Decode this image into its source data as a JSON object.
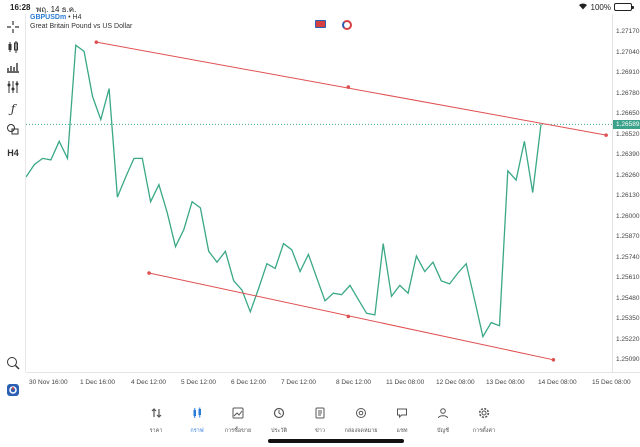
{
  "status_bar": {
    "time": "16:28",
    "date": "พฤ. 14 ธ.ค.",
    "battery": "100%"
  },
  "chart_header": {
    "symbol": "GBPUSDm",
    "timeframe": "H4",
    "separator": " • ",
    "description": "Great Britain Pound vs US Dollar"
  },
  "toolbar": {
    "items": [
      "crosshair-icon",
      "candles-icon",
      "indicators-icon",
      "objects-icon",
      "functions-icon",
      "shapes-icon",
      "timeframe-icon"
    ],
    "timeframe_label": "H4"
  },
  "current_price": "1.26589",
  "chart_data": {
    "type": "line",
    "x_ticks": [
      "30 Nov 16:00",
      "1 Dec 16:00",
      "4 Dec 12:00",
      "5 Dec 12:00",
      "6 Dec 12:00",
      "7 Dec 12:00",
      "8 Dec 12:00",
      "11 Dec 08:00",
      "12 Dec 08:00",
      "13 Dec 08:00",
      "14 Dec 08:00",
      "15 Dec 08:00"
    ],
    "y_ticks": [
      "1.27170",
      "1.27040",
      "1.26910",
      "1.26780",
      "1.26650",
      "1.26520",
      "1.26390",
      "1.26260",
      "1.26130",
      "1.26000",
      "1.25870",
      "1.25740",
      "1.25610",
      "1.25480",
      "1.25350",
      "1.25220",
      "1.25090"
    ],
    "ylim": [
      1.2503,
      1.2725
    ],
    "series": [
      {
        "color": "#3aa887",
        "values": [
          1.2625,
          1.2633,
          1.2637,
          1.2636,
          1.2648,
          1.2637,
          1.271,
          1.2706,
          1.2677,
          1.2662,
          1.2682,
          1.2612,
          1.2625,
          1.2637,
          1.2637,
          1.2609,
          1.262,
          1.2602,
          1.258,
          1.2591,
          1.2609,
          1.2605,
          1.2577,
          1.257,
          1.2577,
          1.2558,
          1.2552,
          1.2538,
          1.2553,
          1.2569,
          1.2566,
          1.2582,
          1.2578,
          1.2564,
          1.2575,
          1.256,
          1.2545,
          1.255,
          1.2549,
          1.2555,
          1.2546,
          1.2537,
          1.2536,
          1.2582,
          1.2548,
          1.2555,
          1.255,
          1.2574,
          1.2564,
          1.257,
          1.2558,
          1.2556,
          1.2563,
          1.2569,
          1.2546,
          1.2522,
          1.2531,
          1.2529,
          1.2629,
          1.2623,
          1.2648,
          1.2615,
          1.2659
        ]
      }
    ],
    "channel_upper": {
      "x": [
        0.12,
        0.55,
        0.99
      ],
      "y": [
        1.2712,
        1.2683,
        1.2652
      ]
    },
    "channel_lower": {
      "x": [
        0.21,
        0.55,
        0.9
      ],
      "y": [
        1.2563,
        1.2535,
        1.2507
      ]
    },
    "current_line": 1.26589,
    "grid": false
  },
  "bottom_nav": [
    {
      "label": "ราคา",
      "icon": "quotes-icon",
      "active": false
    },
    {
      "label": "กราฟ",
      "icon": "chart-icon",
      "active": true
    },
    {
      "label": "การซื้อขาย",
      "icon": "trade-icon",
      "active": false
    },
    {
      "label": "ประวัติ",
      "icon": "history-icon",
      "active": false
    },
    {
      "label": "ข่าว",
      "icon": "news-icon",
      "active": false
    },
    {
      "label": "กล่องจดหมาย",
      "icon": "mailbox-icon",
      "active": false
    },
    {
      "label": "แชท",
      "icon": "chat-icon",
      "active": false
    },
    {
      "label": "บัญชี",
      "icon": "accounts-icon",
      "active": false
    },
    {
      "label": "การตั้งค่า",
      "icon": "settings-icon",
      "active": false
    }
  ],
  "colors": {
    "line": "#3aa887",
    "channel": "#e05050",
    "accent": "#2b7bd9"
  }
}
